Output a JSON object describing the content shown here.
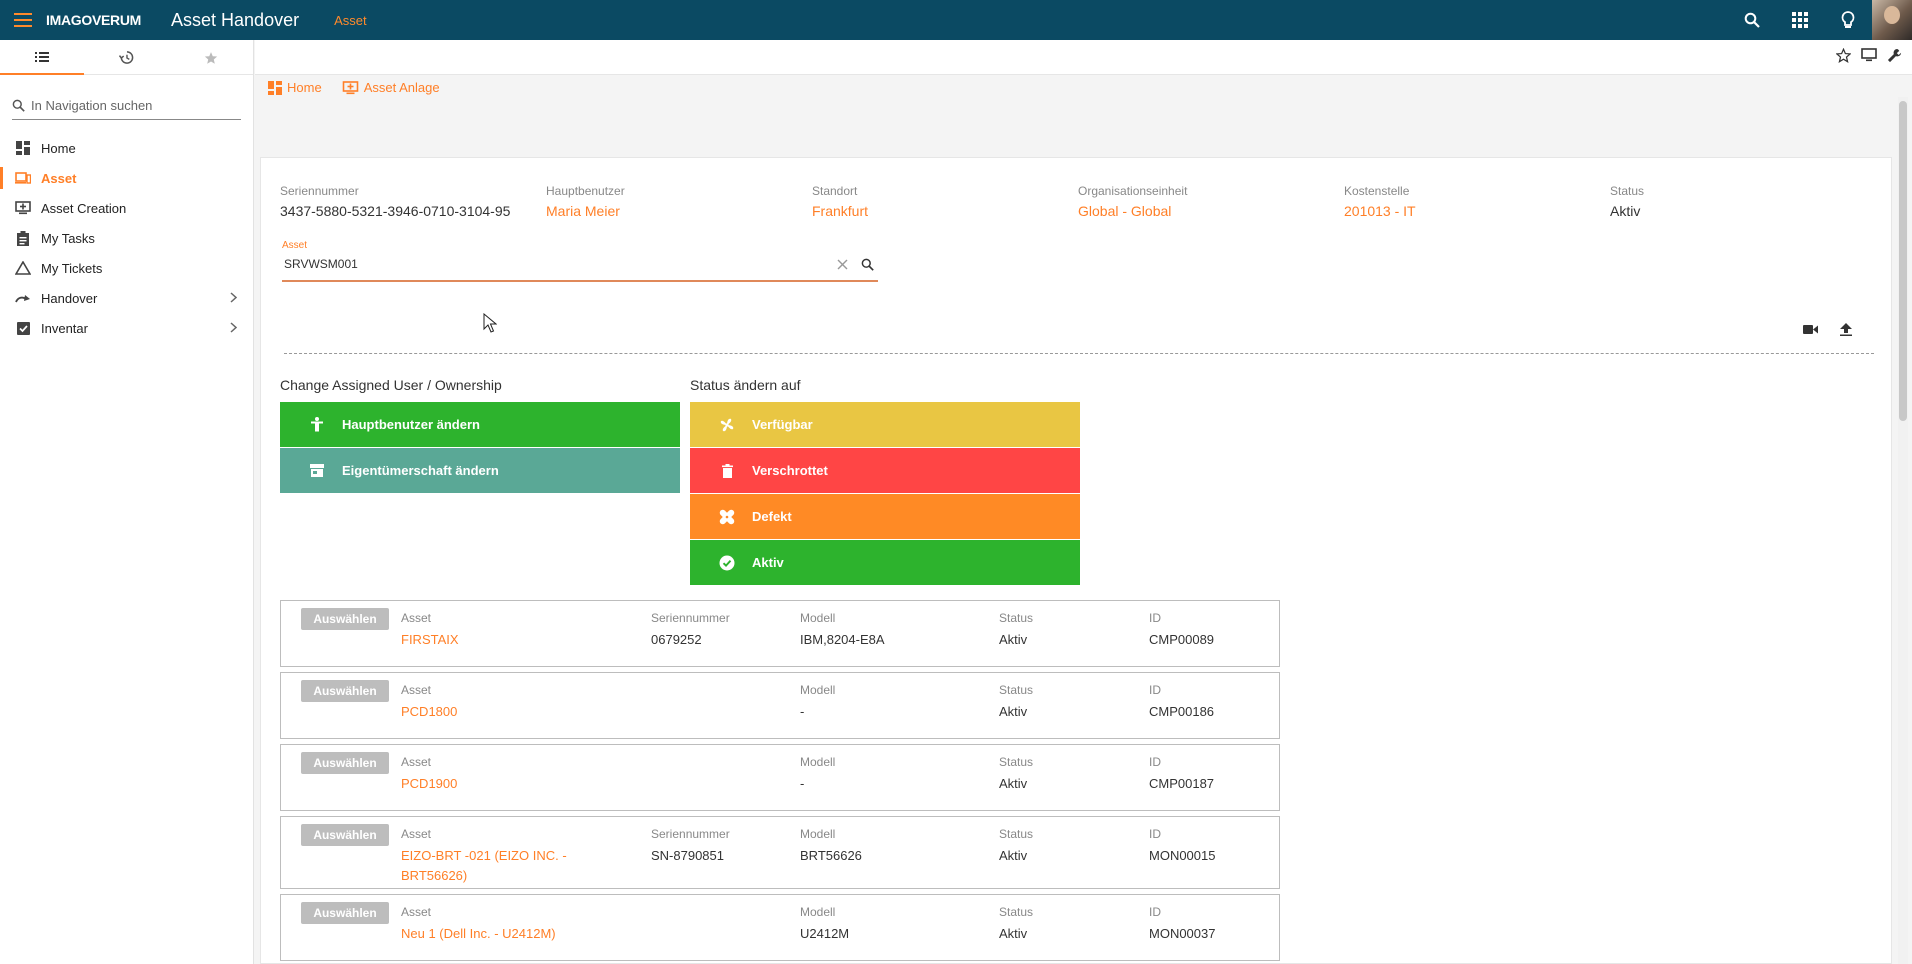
{
  "topbar": {
    "brand": "IMAGOVERUM",
    "title": "Asset Handover",
    "module": "Asset"
  },
  "sidebar": {
    "search_placeholder": "In Navigation suchen",
    "items": [
      {
        "label": "Home"
      },
      {
        "label": "Asset"
      },
      {
        "label": "Asset Creation"
      },
      {
        "label": "My Tasks"
      },
      {
        "label": "My Tickets"
      },
      {
        "label": "Handover"
      },
      {
        "label": "Inventar"
      }
    ]
  },
  "breadcrumb": {
    "home": "Home",
    "asset_anlage": "Asset Anlage"
  },
  "asset_header": {
    "serial_label": "Seriennummer",
    "serial_value": "3437-5880-5321-3946-0710-3104-95",
    "user_label": "Hauptbenutzer",
    "user_value": "Maria Meier",
    "location_label": "Standort",
    "location_value": "Frankfurt",
    "org_label": "Organisationseinheit",
    "org_value": "Global - Global",
    "cost_label": "Kostenstelle",
    "cost_value": "201013 - IT",
    "status_label": "Status",
    "status_value": "Aktiv"
  },
  "asset_input": {
    "label": "Asset",
    "value": "SRVWSM001"
  },
  "ownership": {
    "title": "Change Assigned User / Ownership",
    "change_user": "Hauptbenutzer ändern",
    "change_owner": "Eigentümerschaft ändern"
  },
  "status_change": {
    "title": "Status ändern auf",
    "available": "Verfügbar",
    "scrapped": "Verschrottet",
    "defect": "Defekt",
    "active": "Aktiv"
  },
  "colors": {
    "topbar": "#0b4a63",
    "accent": "#ff7f27",
    "green": "#2db32d",
    "teal": "#5aa896",
    "yellow": "#e9c643",
    "red": "#ff4545",
    "orange": "#ff8a25"
  },
  "list": {
    "select_label": "Auswählen",
    "col_asset": "Asset",
    "col_serial": "Seriennummer",
    "col_model": "Modell",
    "col_status": "Status",
    "col_id": "ID",
    "rows": [
      {
        "asset": "FIRSTAIX",
        "serial": "0679252",
        "model": "IBM,8204-E8A",
        "status": "Aktiv",
        "id": "CMP00089"
      },
      {
        "asset": "PCD1800",
        "serial": "",
        "model": "-",
        "status": "Aktiv",
        "id": "CMP00186"
      },
      {
        "asset": "PCD1900",
        "serial": "",
        "model": "-",
        "status": "Aktiv",
        "id": "CMP00187"
      },
      {
        "asset": "EIZO-BRT -021 (EIZO INC. - BRT56626)",
        "serial": "SN-8790851",
        "model": "BRT56626",
        "status": "Aktiv",
        "id": "MON00015"
      },
      {
        "asset": "Neu 1 (Dell Inc. - U2412M)",
        "serial": "",
        "model": "U2412M",
        "status": "Aktiv",
        "id": "MON00037"
      }
    ]
  }
}
